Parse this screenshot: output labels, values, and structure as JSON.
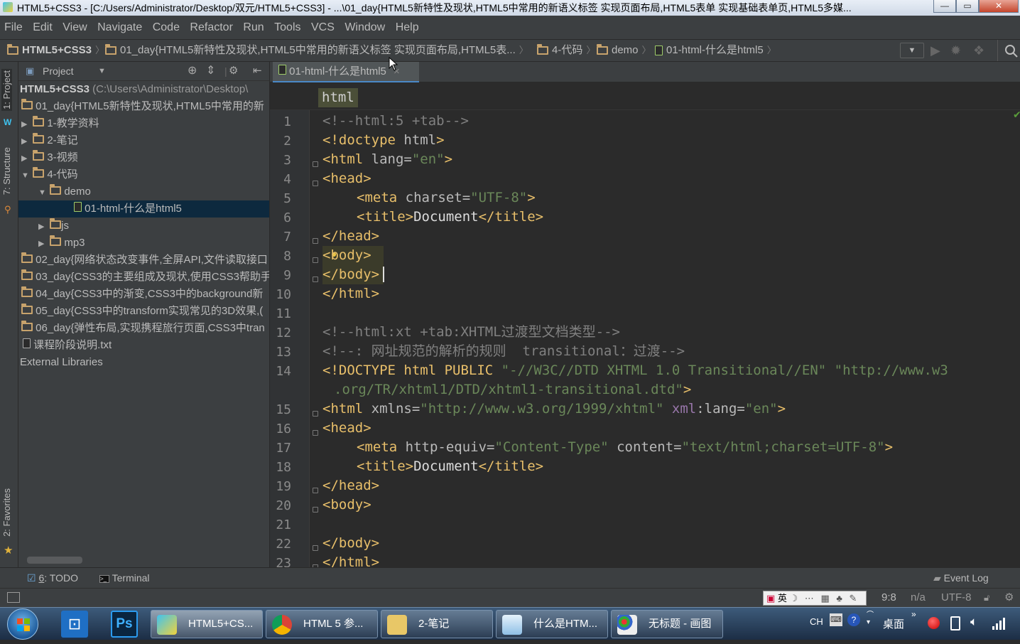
{
  "window": {
    "title": "HTML5+CSS3 - [C:/Users/Administrator/Desktop/双元/HTML5+CSS3] - ...\\01_day{HTML5新特性及现状,HTML5中常用的新语义标签 实现页面布局,HTML5表单 实现基础表单页,HTML5多媒...",
    "min": "—",
    "max": "▭",
    "close": "✕"
  },
  "menu": [
    "File",
    "Edit",
    "View",
    "Navigate",
    "Code",
    "Refactor",
    "Run",
    "Tools",
    "VCS",
    "Window",
    "Help"
  ],
  "nav": {
    "c1": "HTML5+CSS3",
    "c2": "01_day{HTML5新特性及现状,HTML5中常用的新语义标签 实现页面布局,HTML5表...",
    "c3": "4-代码",
    "c4": "demo",
    "c5": "01-html-什么是html5"
  },
  "side_tabs": {
    "project": "1: Project",
    "structure": "7: Structure",
    "favorites": "2: Favorites"
  },
  "project": {
    "header": "Project",
    "root_name": "HTML5+CSS3",
    "root_path": "(C:\\Users\\Administrator\\Desktop\\",
    "items": [
      "01_day{HTML5新特性及现状,HTML5中常用的新",
      "1-教学资料",
      "2-笔记",
      "3-视频",
      "4-代码",
      "demo",
      "01-html-什么是html5",
      "js",
      "mp3",
      "02_day{网络状态改变事件,全屏API,文件读取接口",
      "03_day{CSS3的主要组成及现状,使用CSS3帮助手",
      "04_day{CSS3中的渐变,CSS3中的background新",
      "05_day{CSS3中的transform实现常见的3D效果,(",
      "06_day{弹性布局,实现携程旅行页面,CSS3中tran",
      "课程阶段说明.txt",
      "External Libraries"
    ]
  },
  "editor": {
    "tab": "01-html-什么是html5",
    "breadcrumb": "html",
    "line_numbers": [
      "1",
      "2",
      "3",
      "4",
      "5",
      "6",
      "7",
      "8",
      "9",
      "10",
      "11",
      "12",
      "13",
      "14",
      "",
      "15",
      "16",
      "17",
      "18",
      "19",
      "20",
      "21",
      "22",
      "23"
    ],
    "code": {
      "l1": "<!--html:5 +tab-->",
      "l2a": "<!doctype ",
      "l2b": "html",
      "l2c": ">",
      "l3a": "<html ",
      "l3b": "lang=",
      "l3c": "\"en\"",
      "l3d": ">",
      "l4": "<head>",
      "l5a": "<meta ",
      "l5b": "charset=",
      "l5c": "\"UTF-8\"",
      "l5d": ">",
      "l6a": "<title>",
      "l6b": "Document",
      "l6c": "</title>",
      "l7": "</head>",
      "l8": "<body>",
      "l9": "</body>",
      "l10": "</html>",
      "l12": "<!--html:xt +tab:XHTML过渡型文档类型-->",
      "l13": "<!--: 网址规范的解析的规则  transitional：过渡-->",
      "l14a": "<!DOCTYPE html PUBLIC ",
      "l14b": "\"-//W3C//DTD XHTML 1.0 Transitional//EN\" \"http://www.w3",
      "l14c": ".org/TR/xhtml1/DTD/xhtml1-transitional.dtd\"",
      "l14d": ">",
      "l15a": "<html ",
      "l15b": "xmlns=",
      "l15c": "\"http://www.w3.org/1999/xhtml\" ",
      "l15d": "xml",
      "l15e": ":lang=",
      "l15f": "\"en\"",
      "l15g": ">",
      "l16": "<head>",
      "l17a": "<meta ",
      "l17b": "http-equiv=",
      "l17c": "\"Content-Type\" ",
      "l17d": "content=",
      "l17e": "\"text/html;charset=UTF-8\"",
      "l17f": ">",
      "l18a": "<title>",
      "l18b": "Document",
      "l18c": "</title>",
      "l19": "</head>",
      "l20": "<body>",
      "l22": "</body>",
      "l23": "</html>"
    }
  },
  "bottom": {
    "todo_num": "6",
    "todo": ": TODO",
    "terminal": "Terminal",
    "eventlog": "Event Log"
  },
  "status": {
    "ime": "英",
    "position": "9:8",
    "na": "n/a",
    "encoding": "UTF-8"
  },
  "taskbar": {
    "buttons": [
      "HTML5+CS...",
      "HTML 5 参...",
      "2-笔记",
      "什么是HTM...",
      "无标题 - 画图"
    ],
    "lang": "CH",
    "desktop": "桌面"
  },
  "colors": {
    "tag": "#e8bf6a",
    "string": "#6a8759",
    "comment": "#808080",
    "text": "#a9b7c6"
  }
}
